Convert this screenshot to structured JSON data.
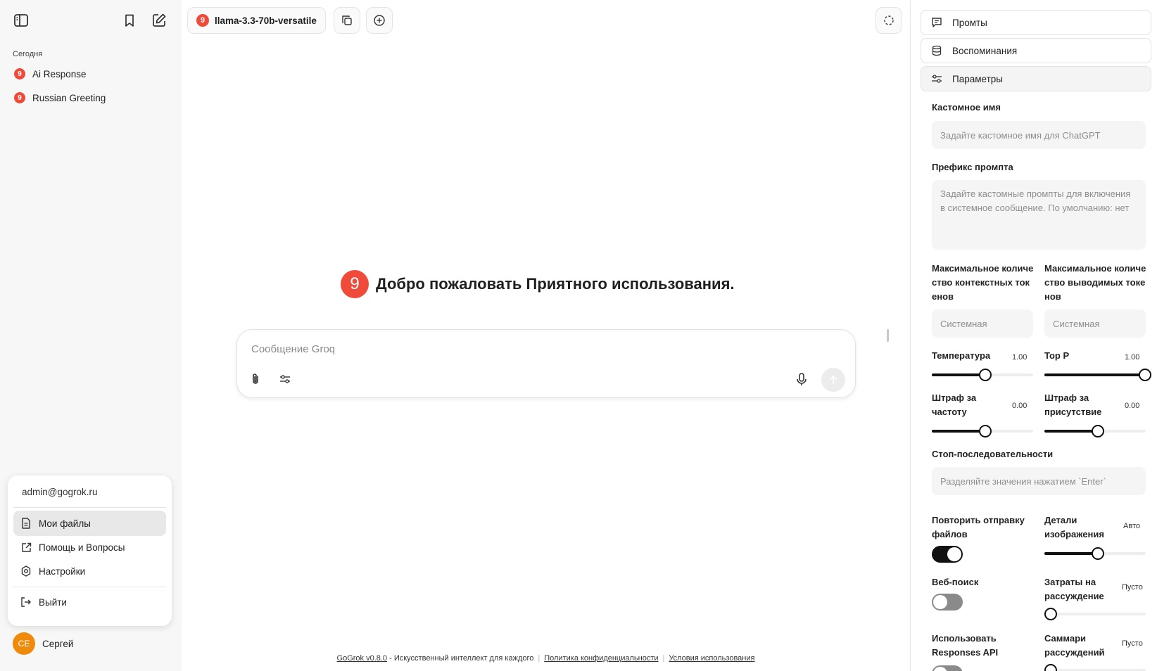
{
  "sidebar": {
    "section_label": "Сегодня",
    "chats": [
      {
        "label": "Ai Response",
        "badge": "9"
      },
      {
        "label": "Russian Greeting",
        "badge": "9"
      }
    ],
    "user_menu": {
      "email": "admin@gogrok.ru",
      "items": [
        {
          "label": "Мои файлы",
          "icon": "file-icon"
        },
        {
          "label": "Помощь и Вопросы",
          "icon": "external-link-icon"
        },
        {
          "label": "Настройки",
          "icon": "gear-icon"
        },
        {
          "label": "Выйти",
          "icon": "logout-icon"
        }
      ]
    },
    "user": {
      "initials": "СЕ",
      "name": "Сергей",
      "avatar_color": "#f08a0a"
    }
  },
  "main": {
    "model_name": "llama-3.3-70b-versatile",
    "model_badge": "9",
    "welcome_logo": "9",
    "welcome_text": "Добро пожаловать Приятного использования.",
    "composer_placeholder": "Сообщение Groq",
    "footer": {
      "brand": "GoGrok v0.8.0",
      "tagline": " - Искусственный интеллект для каждого",
      "privacy": "Политика конфиденциальности",
      "terms": "Условия использования"
    }
  },
  "right_panel": {
    "tabs": [
      {
        "label": "Промты",
        "icon": "message-icon"
      },
      {
        "label": "Воспоминания",
        "icon": "database-icon"
      },
      {
        "label": "Параметры",
        "icon": "sliders-icon"
      }
    ],
    "custom_name_label": "Кастомное имя",
    "custom_name_placeholder": "Задайте кастомное имя для ChatGPT",
    "prompt_prefix_label": "Префикс промпта",
    "prompt_prefix_placeholder": "Задайте кастомные промпты для включения в системное сообщение. По умолчанию: нет",
    "max_context_label": "Максимальное количество контекстных токенов",
    "max_context_placeholder": "Системная",
    "max_output_label": "Максимальное количество выводимых токенов",
    "max_output_placeholder": "Системная",
    "temperature": {
      "label": "Температура",
      "value": "1.00",
      "fraction": 0.5
    },
    "top_p": {
      "label": "Top P",
      "value": "1.00",
      "fraction": 1.0
    },
    "freq_penalty": {
      "label": "Штраф за частоту",
      "value": "0.00",
      "fraction": 0.5
    },
    "presence_penalty": {
      "label": "Штраф за присутствие",
      "value": "0.00",
      "fraction": 0.5
    },
    "stop_label": "Стоп-последовательности",
    "stop_placeholder": "Разделяйте значения нажатием `Enter`",
    "resend_files": {
      "label": "Повторить отправку файлов",
      "on": true
    },
    "image_detail": {
      "label": "Детали изображения",
      "value": "Авто",
      "fraction": 0.5
    },
    "web_search": {
      "label": "Веб-поиск",
      "on": false
    },
    "reasoning_cost": {
      "label": "Затраты на рассуждение",
      "value": "Пусто",
      "fraction": 0.0
    },
    "responses_api": {
      "label": "Использовать Responses API"
    },
    "reasoning_summary": {
      "label": "Саммари рассуждений",
      "value": "Пусто",
      "fraction": 0.0
    }
  },
  "colors": {
    "brand": "#ef4a3a",
    "avatar": "#f08a0a",
    "slider": "#111111"
  }
}
